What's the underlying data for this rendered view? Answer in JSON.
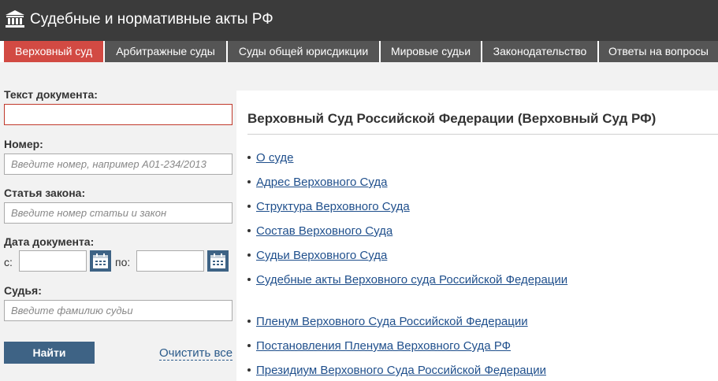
{
  "header": {
    "title": "Судебные и нормативные акты РФ"
  },
  "nav": {
    "tabs": [
      {
        "label": "Верховный суд"
      },
      {
        "label": "Арбитражные суды"
      },
      {
        "label": "Суды общей юрисдикции"
      },
      {
        "label": "Мировые судьи"
      },
      {
        "label": "Законодательство"
      },
      {
        "label": "Ответы на вопросы"
      }
    ]
  },
  "form": {
    "doc_text": {
      "label": "Текст документа:",
      "value": "",
      "placeholder": ""
    },
    "number": {
      "label": "Номер:",
      "value": "",
      "placeholder": "Введите номер, например А01-234/2013"
    },
    "article": {
      "label": "Статья закона:",
      "value": "",
      "placeholder": "Введите номер статьи и закон"
    },
    "date": {
      "label": "Дата документа:",
      "from_label": "с:",
      "to_label": "по:",
      "from_value": "",
      "to_value": ""
    },
    "judge": {
      "label": "Судья:",
      "value": "",
      "placeholder": "Введите фамилию судьи"
    },
    "search_label": "Найти",
    "clear_label": "Очистить все"
  },
  "content": {
    "title": "Верховный Суд Российской Федерации (Верховный Суд РФ)",
    "links": [
      "О суде",
      "Адрес Верховного Суда",
      "Структура Верховного Суда",
      "Состав Верховного Суда",
      "Судьи Верховного Суда",
      "Судебные акты Верховного суда Российской Федерации",
      "Пленум Верховного Суда Российской Федерации",
      "Постановления Пленума Верховного Суда РФ",
      "Президиум Верховного Суда Российской Федерации"
    ]
  },
  "icons": {
    "logo": "courthouse-icon",
    "calendar": "calendar-icon"
  },
  "colors": {
    "header_bg": "#3b3b3b",
    "tab_bg": "#555555",
    "tab_active_bg": "#d24a43",
    "button_bg": "#3e6385",
    "link": "#1f4f8c"
  }
}
